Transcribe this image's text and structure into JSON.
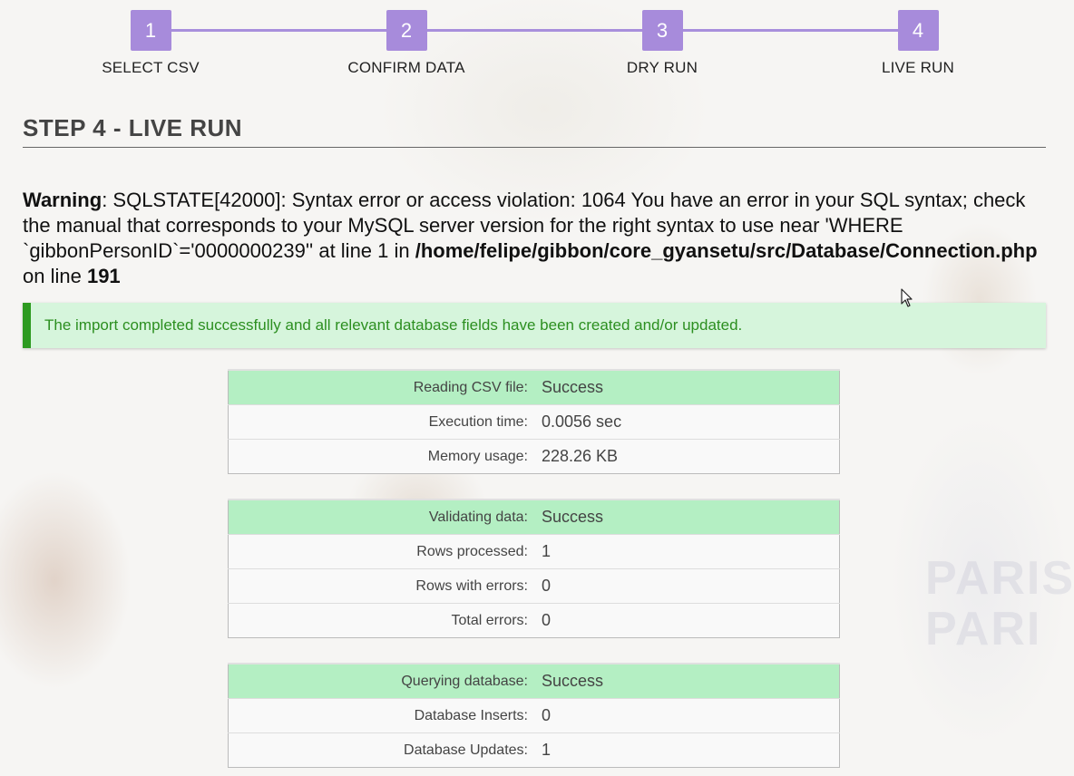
{
  "steps": [
    {
      "num": "1",
      "label": "SELECT CSV"
    },
    {
      "num": "2",
      "label": "CONFIRM DATA"
    },
    {
      "num": "3",
      "label": "DRY RUN"
    },
    {
      "num": "4",
      "label": "LIVE RUN"
    }
  ],
  "heading": "STEP 4 - LIVE RUN",
  "warning": {
    "label": "Warning",
    "message": ": SQLSTATE[42000]: Syntax error or access violation: 1064 You have an error in your SQL syntax; check the manual that corresponds to your MySQL server version for the right syntax to use near 'WHERE `gibbonPersonID`='0000000239'' at line 1 in ",
    "file": "/home/felipe/gibbon/core_gyansetu/src/Database/Connection.php",
    "on_line": " on line ",
    "line": "191"
  },
  "success_message": "The import completed successfully and all relevant database fields have been created and/or updated.",
  "stats": {
    "reading": {
      "head": {
        "label": "Reading CSV file:",
        "value": "Success"
      },
      "rows": [
        {
          "label": "Execution time:",
          "value": "0.0056 sec"
        },
        {
          "label": "Memory usage:",
          "value": "228.26 KB"
        }
      ]
    },
    "validating": {
      "head": {
        "label": "Validating data:",
        "value": "Success"
      },
      "rows": [
        {
          "label": "Rows processed:",
          "value": "1"
        },
        {
          "label": "Rows with errors:",
          "value": "0"
        },
        {
          "label": "Total errors:",
          "value": "0"
        }
      ]
    },
    "querying": {
      "head": {
        "label": "Querying database:",
        "value": "Success"
      },
      "rows": [
        {
          "label": "Database Inserts:",
          "value": "0"
        },
        {
          "label": "Database Updates:",
          "value": "1"
        }
      ]
    }
  },
  "colors": {
    "step_accent": "#a78bdb",
    "success_border": "#2d9a20",
    "success_bg": "#d6f5dc",
    "stat_head_bg": "#b4efc3"
  }
}
